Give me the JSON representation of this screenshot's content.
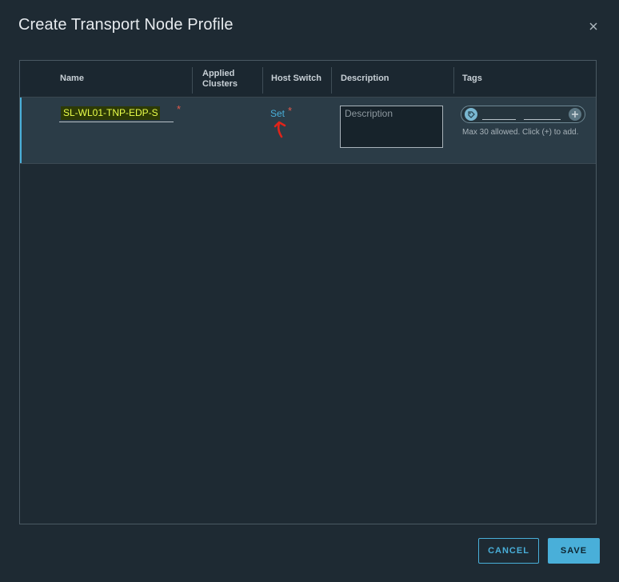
{
  "dialog": {
    "title": "Create Transport Node Profile"
  },
  "grid": {
    "columns": [
      {
        "label": "Name"
      },
      {
        "label": "Applied Clusters"
      },
      {
        "label": "Host Switch"
      },
      {
        "label": "Description"
      },
      {
        "label": "Tags"
      }
    ],
    "row": {
      "name_value": "SL-WL01-TNP-EDP-S",
      "host_switch_link": "Set",
      "required_mark": "*",
      "description_placeholder": "Description",
      "tags": {
        "tag_value": "",
        "scope_value": "",
        "hint": "Max 30 allowed. Click (+) to add."
      }
    }
  },
  "annotation": {
    "arrow_color": "#e0241a"
  },
  "footer": {
    "cancel_label": "CANCEL",
    "save_label": "SAVE"
  },
  "colors": {
    "background": "#1e2a33",
    "accent": "#49afd9",
    "required": "#e05a4c",
    "highlight_text": "#eaff4a"
  }
}
